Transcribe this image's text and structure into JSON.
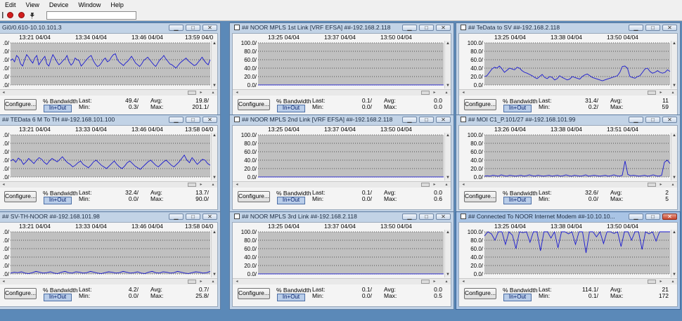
{
  "menubar": [
    "Edit",
    "View",
    "Device",
    "Window",
    "Help"
  ],
  "toolbar": {
    "icons": [
      "record-icon",
      "pin-icon"
    ]
  },
  "common": {
    "configure": "Configure...",
    "bandwidth": "% Bandwidth",
    "inout": "In+Out",
    "last": "Last:",
    "min": "Min:",
    "avg": "Avg:",
    "max": "Max:"
  },
  "windows": [
    {
      "title": "Gi0/0.610-10.10.101.3",
      "times": [
        "13:21 04/04",
        "13:34 04/04",
        "13:46 04/04",
        "13:59 04/0"
      ],
      "ylabels": [
        ".0/",
        ".0/",
        ".0/",
        ".0/",
        ".0/",
        ".0/"
      ],
      "stats": {
        "last": "49.4/",
        "min": "0.3/",
        "avg": "19.8/",
        "max": "201.1/"
      },
      "chart_data": {
        "type": "line",
        "ylim": [
          0,
          100
        ],
        "values": [
          58,
          62,
          55,
          70,
          65,
          50,
          45,
          60,
          72,
          66,
          58,
          52,
          64,
          70,
          48,
          55,
          62,
          68,
          50,
          45,
          60,
          72,
          64,
          55,
          48,
          52,
          58,
          62,
          70,
          55,
          47,
          52,
          64,
          60,
          58,
          45,
          50,
          56,
          62,
          67,
          70,
          58,
          50,
          44,
          46,
          52,
          60,
          64,
          55,
          58,
          66,
          72,
          74,
          60,
          54,
          50,
          46,
          52,
          56,
          62,
          68,
          60,
          52,
          48,
          44,
          50,
          58,
          62,
          66,
          60,
          54,
          48,
          44,
          52,
          60,
          64,
          70,
          62,
          56,
          50,
          48,
          44,
          40,
          46,
          52,
          56,
          60,
          64,
          58,
          54,
          50,
          46,
          48,
          54,
          60,
          66,
          58,
          52,
          48,
          60
        ]
      }
    },
    {
      "title": "## NOOR MPLS 1st Link [VRF EFSA] ##-192.168.2.118",
      "times": [
        "13:25 04/04",
        "13:37 04/04",
        "13:50 04/04"
      ],
      "ylabels": [
        "100.0/",
        "80.0/",
        "60.0/",
        "40.0/",
        "20.0/",
        "0.0/"
      ],
      "stats": {
        "last": "0.1/",
        "min": "0.0/",
        "avg": "0.0",
        "max": "0.0"
      },
      "chart_data": {
        "type": "line",
        "ylim": [
          0,
          100
        ],
        "values": [
          0.1,
          0.1,
          0.1,
          0.1,
          0.1,
          0.1,
          0.1,
          0.1,
          0.1,
          0.1
        ]
      }
    },
    {
      "title": "## TeData to SV ##-192.168.2.118",
      "times": [
        "13:25 04/04",
        "13:38 04/04",
        "13:50 04/04"
      ],
      "ylabels": [
        "100.0/",
        "80.0/",
        "60.0/",
        "40.0/",
        "20.0/",
        "0.0/"
      ],
      "stats": {
        "last": "31.4/",
        "min": "0.2/",
        "avg": "11",
        "max": "59"
      },
      "chart_data": {
        "type": "line",
        "ylim": [
          0,
          100
        ],
        "values": [
          20,
          22,
          30,
          38,
          42,
          40,
          45,
          38,
          30,
          35,
          40,
          38,
          36,
          42,
          40,
          34,
          30,
          28,
          25,
          22,
          18,
          15,
          20,
          25,
          18,
          15,
          20,
          18,
          12,
          15,
          22,
          18,
          15,
          12,
          14,
          20,
          18,
          16,
          14,
          20,
          24,
          26,
          22,
          18,
          16,
          14,
          12,
          10,
          12,
          14,
          16,
          18,
          20,
          22,
          30,
          44,
          45,
          40,
          20,
          18,
          16,
          20,
          22,
          30,
          38,
          40,
          32,
          28,
          30,
          34,
          30,
          28,
          30,
          36,
          32
        ]
      }
    },
    {
      "title": "## TEData 6 M To TH ##-192.168.101.100",
      "times": [
        "13:21 04/04",
        "13:33 04/04",
        "13:46 04/04",
        "13:58 04/0"
      ],
      "ylabels": [
        ".0/",
        ".0/",
        ".0/",
        ".0/",
        ".0/",
        ".0/"
      ],
      "stats": {
        "last": "32.4/",
        "min": "0.0/",
        "avg": "13.7/",
        "max": "90.0/"
      },
      "chart_data": {
        "type": "line",
        "ylim": [
          0,
          100
        ],
        "values": [
          38,
          42,
          35,
          45,
          40,
          30,
          36,
          44,
          38,
          32,
          40,
          46,
          42,
          35,
          30,
          38,
          44,
          40,
          36,
          42,
          48,
          40,
          34,
          30,
          24,
          28,
          34,
          38,
          30,
          26,
          22,
          28,
          36,
          40,
          34,
          28,
          24,
          20,
          26,
          32,
          38,
          30,
          24,
          20,
          26,
          34,
          38,
          32,
          26,
          22,
          18,
          24,
          30,
          36,
          40,
          34,
          28,
          24,
          30,
          36,
          40,
          34,
          28,
          24,
          30,
          36,
          44,
          52,
          40,
          34,
          46,
          38,
          30,
          36,
          42,
          40,
          32,
          28
        ]
      }
    },
    {
      "title": "## NOOR MPLS 2nd Link [VRF EFSA] ##-192.168.2.118",
      "times": [
        "13:25 04/04",
        "13:37 04/04",
        "13:50 04/04"
      ],
      "ylabels": [
        "100.0/",
        "80.0/",
        "60.0/",
        "40.0/",
        "20.0/",
        "0.0/"
      ],
      "stats": {
        "last": "0.1/",
        "min": "0.0/",
        "avg": "0.0",
        "max": "0.6"
      },
      "chart_data": {
        "type": "line",
        "ylim": [
          0,
          100
        ],
        "values": [
          0.1,
          0.1,
          0.1,
          0.1,
          0.1,
          0.1,
          0.1,
          0.1,
          0.1,
          0.1
        ]
      }
    },
    {
      "title": "## MOI C1_P.101/27 ##-192.168.101.99",
      "times": [
        "13:26 04/04",
        "13:38 04/04",
        "13:51 04/04"
      ],
      "ylabels": [
        "100.0/",
        "80.0/",
        "60.0/",
        "40.0/",
        "20.0/",
        "0.0/"
      ],
      "stats": {
        "last": "32.6/",
        "min": "0.0/",
        "avg": "2",
        "max": "5"
      },
      "chart_data": {
        "type": "line",
        "ylim": [
          0,
          100
        ],
        "values": [
          2,
          3,
          2,
          4,
          3,
          2,
          5,
          3,
          2,
          4,
          3,
          2,
          3,
          4,
          2,
          3,
          5,
          3,
          2,
          4,
          3,
          2,
          3,
          4,
          2,
          3,
          4,
          2,
          3,
          5,
          3,
          2,
          4,
          3,
          2,
          3,
          5,
          2,
          3,
          4,
          3,
          2,
          3,
          4,
          2,
          3,
          5,
          3,
          2,
          4,
          38,
          6,
          3,
          4,
          3,
          2,
          3,
          4,
          2,
          3,
          5,
          3,
          2,
          4,
          35,
          40,
          32
        ]
      }
    },
    {
      "title": "## SV-TH-NOOR ##-192.168.101.98",
      "times": [
        "13:21 04/04",
        "13:33 04/04",
        "13:46 04/04",
        "13:58 04/0"
      ],
      "ylabels": [
        ".0/",
        ".0/",
        ".0/",
        ".0/",
        ".0/",
        ".0/"
      ],
      "stats": {
        "last": "4.2/",
        "min": "0.0/",
        "avg": "0.7/",
        "max": "25.8/"
      },
      "chart_data": {
        "type": "line",
        "ylim": [
          0,
          100
        ],
        "values": [
          2,
          4,
          3,
          5,
          2,
          1,
          3,
          6,
          4,
          2,
          3,
          5,
          2,
          1,
          4,
          6,
          3,
          2,
          5,
          4,
          2,
          3,
          6,
          4,
          2,
          1,
          3,
          5,
          4,
          2,
          3,
          6,
          4,
          2,
          3,
          5,
          2,
          1,
          4,
          6,
          3,
          2,
          5,
          4,
          2,
          3,
          6,
          4,
          2,
          1,
          3,
          5,
          4,
          2,
          3,
          6
        ]
      }
    },
    {
      "title": "## NOOR MPLS 3rd Link ##-192.168.2.118",
      "times": [
        "13:25 04/04",
        "13:37 04/04",
        "13:50 04/04"
      ],
      "ylabels": [
        "100.0/",
        "80.0/",
        "60.0/",
        "40.0/",
        "20.0/",
        "0.0/"
      ],
      "stats": {
        "last": "0.1/",
        "min": "0.0/",
        "avg": "0.0",
        "max": "0.5"
      },
      "chart_data": {
        "type": "line",
        "ylim": [
          0,
          100
        ],
        "values": [
          0.1,
          0.1,
          0.1,
          0.1,
          0.1,
          0.1,
          0.1,
          0.1,
          0.1,
          0.1
        ]
      }
    },
    {
      "title": "## Connected To NOOR Internet Modem ##-10.10.10...",
      "times": [
        "13:25 04/04",
        "13:38 04/04",
        "13:50 04/04"
      ],
      "ylabels": [
        "100.0/",
        "80.0/",
        "60.0/",
        "40.0/",
        "20.0/",
        "0.0/"
      ],
      "stats": {
        "last": "114.1/",
        "min": "0.1/",
        "avg": "21",
        "max": "172"
      },
      "chart_data": {
        "type": "line",
        "ylim": [
          0,
          100
        ],
        "values": [
          90,
          100,
          95,
          80,
          100,
          100,
          70,
          100,
          92,
          60,
          100,
          98,
          100,
          75,
          100,
          100,
          55,
          100,
          100,
          85,
          100,
          62,
          100,
          100,
          95,
          100,
          70,
          100,
          100,
          50,
          100,
          100,
          88,
          100,
          72,
          100,
          100,
          96,
          100,
          65,
          100,
          100,
          80,
          100,
          100,
          58,
          100,
          95,
          100,
          78,
          100,
          100,
          100,
          100
        ]
      }
    }
  ]
}
